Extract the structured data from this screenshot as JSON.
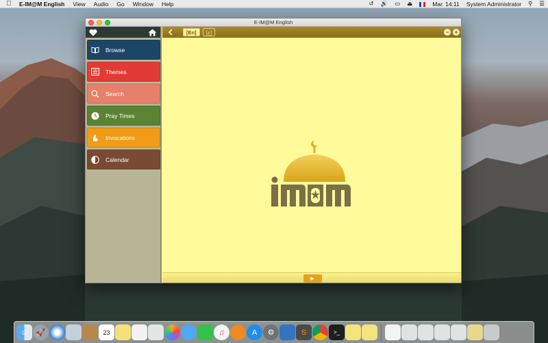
{
  "menubar": {
    "app_name": "E-IM@M English",
    "items": [
      "View",
      "Audio",
      "Go",
      "Window",
      "Help"
    ],
    "clock": "Mar. 14:11",
    "user": "System Administrator"
  },
  "window": {
    "title": "E-IM@M English"
  },
  "toolbar": {
    "lang_en": "[En]",
    "lang_ar": "[ع]"
  },
  "sidebar": {
    "items": [
      {
        "label": "Browse",
        "color": "#1d4565",
        "icon": "book-icon"
      },
      {
        "label": "Themes",
        "color": "#e23b36",
        "icon": "list-icon"
      },
      {
        "label": "Search",
        "color": "#e7806a",
        "icon": "search-icon"
      },
      {
        "label": "Pray Times",
        "color": "#5b8334",
        "icon": "clock-icon"
      },
      {
        "label": "Invocations",
        "color": "#f09c17",
        "icon": "praying-hands-icon"
      },
      {
        "label": "Calendar",
        "color": "#7a4a33",
        "icon": "moon-icon"
      }
    ]
  },
  "logo": {
    "text": "iM@M"
  },
  "dock": {
    "apps": [
      "finder",
      "launchpad",
      "safari",
      "preview",
      "contacts",
      "calendar",
      "notes",
      "reminders",
      "photos",
      "messages",
      "facetime",
      "itunes",
      "ibooks",
      "app-store",
      "system-preferences",
      "instruments",
      "sublime-text",
      "chrome",
      "terminal",
      "imam-app",
      "imam-app-2",
      "documents",
      "window-1",
      "window-2",
      "window-3",
      "window-4",
      "window-5",
      "trash"
    ]
  }
}
